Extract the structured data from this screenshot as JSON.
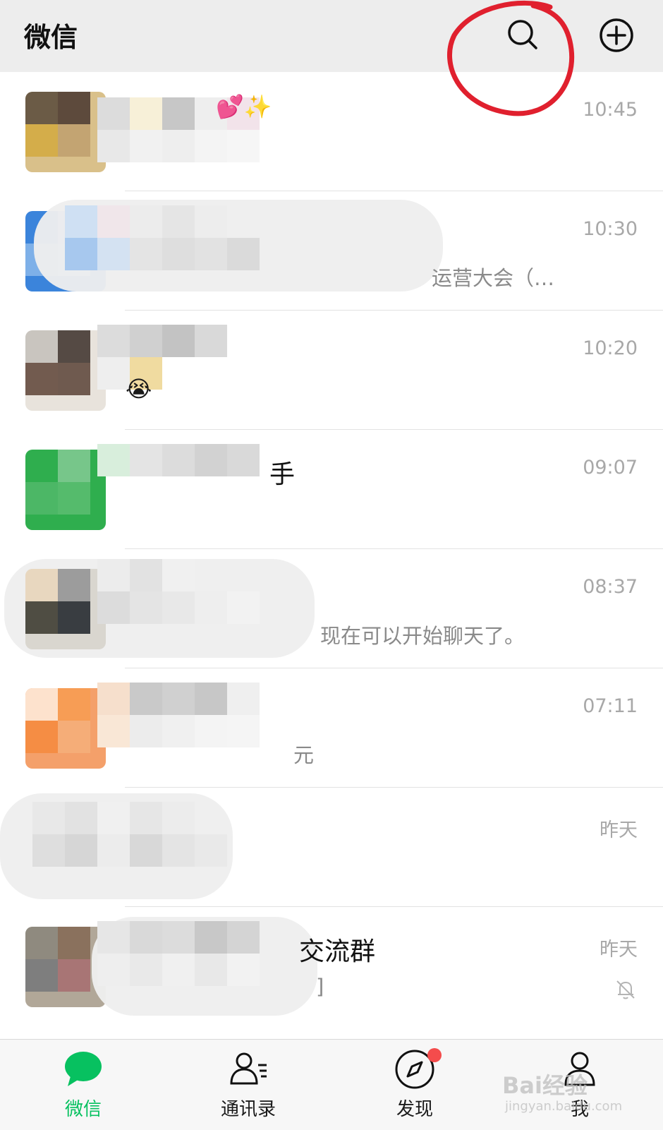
{
  "header": {
    "title": "微信"
  },
  "chats": [
    {
      "name": "",
      "preview": "",
      "time": "10:45",
      "emoji": "💕✨"
    },
    {
      "name": "",
      "preview": "运营大会（…",
      "time": "10:30"
    },
    {
      "name": "",
      "preview": "",
      "time": "10:20",
      "emoji": "😭"
    },
    {
      "name": "手",
      "preview": "",
      "time": "09:07"
    },
    {
      "name": "",
      "preview": "现在可以开始聊天了。",
      "time": "08:37"
    },
    {
      "name": "",
      "preview": "元",
      "time": "07:11"
    },
    {
      "name": "",
      "preview": "",
      "time": "昨天"
    },
    {
      "name": "交流群",
      "preview": "]",
      "time": "昨天",
      "muted": true
    }
  ],
  "tabs": [
    {
      "label": "微信",
      "icon": "chat-bubble-icon",
      "active": true
    },
    {
      "label": "通讯录",
      "icon": "contacts-icon"
    },
    {
      "label": "发现",
      "icon": "compass-icon",
      "badge": true
    },
    {
      "label": "我",
      "icon": "person-icon"
    }
  ],
  "watermark": {
    "text": "Bai经验",
    "sub": "jingyan.baidu.com"
  },
  "colors": {
    "accent": "#07c160",
    "header_bg": "#ededed",
    "badge": "#f44c4c",
    "annotation": "#e0202e"
  }
}
